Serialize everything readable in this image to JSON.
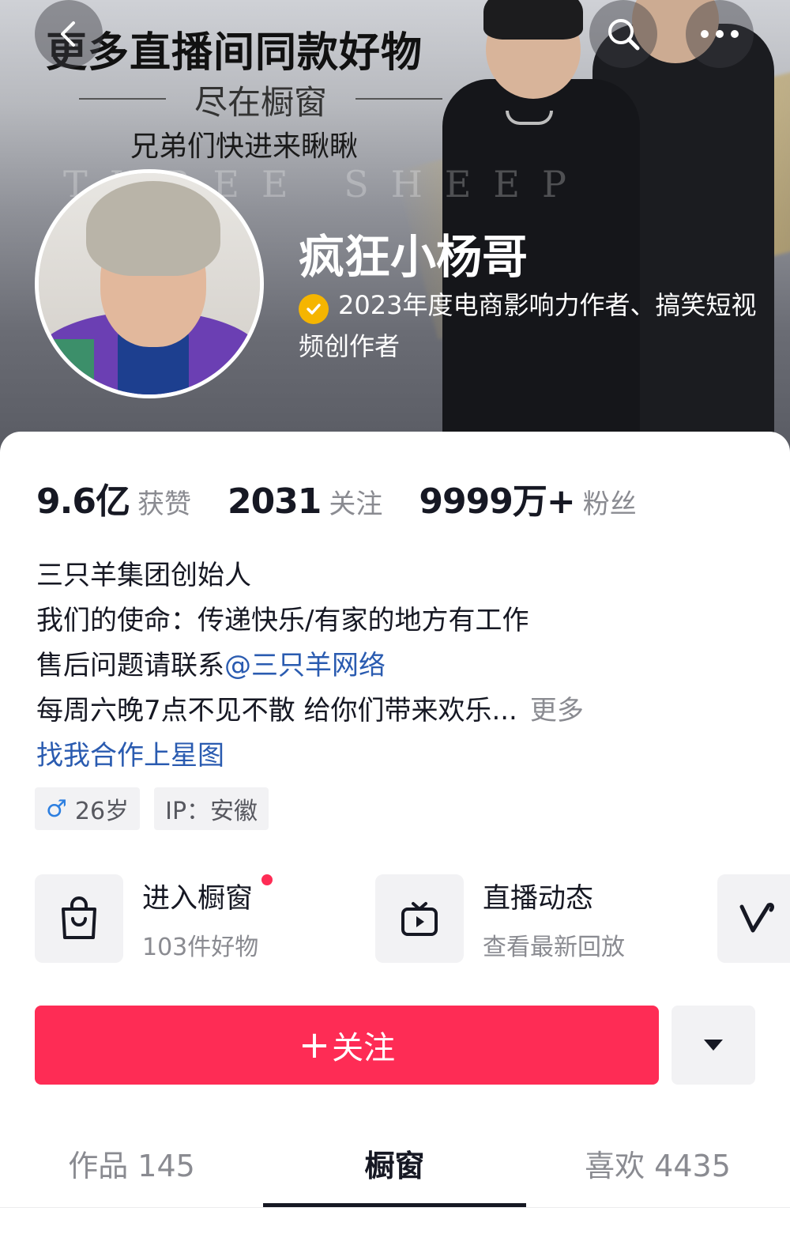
{
  "banner": {
    "headline": "更多直播间同款好物",
    "subline": "尽在橱窗",
    "tagline": "兄弟们快进来瞅瞅",
    "watermark": "THREE SHEEP"
  },
  "profile": {
    "name": "疯狂小杨哥",
    "verification": "2023年度电商影响力作者、搞笑短视频创作者",
    "verification_color": "#f5b500"
  },
  "stats": [
    {
      "value": "9.6亿",
      "label": "获赞"
    },
    {
      "value": "2031",
      "label": "关注"
    },
    {
      "value": "9999万+",
      "label": "粉丝"
    }
  ],
  "bio": {
    "line1": "三只羊集团创始人",
    "line2": "我们的使命：传递快乐/有家的地方有工作",
    "line3_prefix": "售后问题请联系",
    "line3_link": "@三只羊网络",
    "line4": "每周六晚7点不见不散 给你们带来欢乐...",
    "more": "更多",
    "cta": "找我合作上星图"
  },
  "tags": {
    "age": "26岁",
    "ip": "IP：安徽"
  },
  "features": [
    {
      "title": "进入橱窗",
      "subtitle": "103件好物",
      "icon": "shopping-bag-icon"
    },
    {
      "title": "直播动态",
      "subtitle": "查看最新回放",
      "icon": "live-tv-icon"
    },
    {
      "title": "",
      "subtitle": "",
      "icon": "v-logo-icon"
    }
  ],
  "actions": {
    "follow_label": "关注",
    "follow_color": "#fe2c55"
  },
  "tabs": [
    {
      "label": "作品 145"
    },
    {
      "label": "橱窗"
    },
    {
      "label": "喜欢 4435"
    }
  ],
  "active_tab": "橱窗"
}
